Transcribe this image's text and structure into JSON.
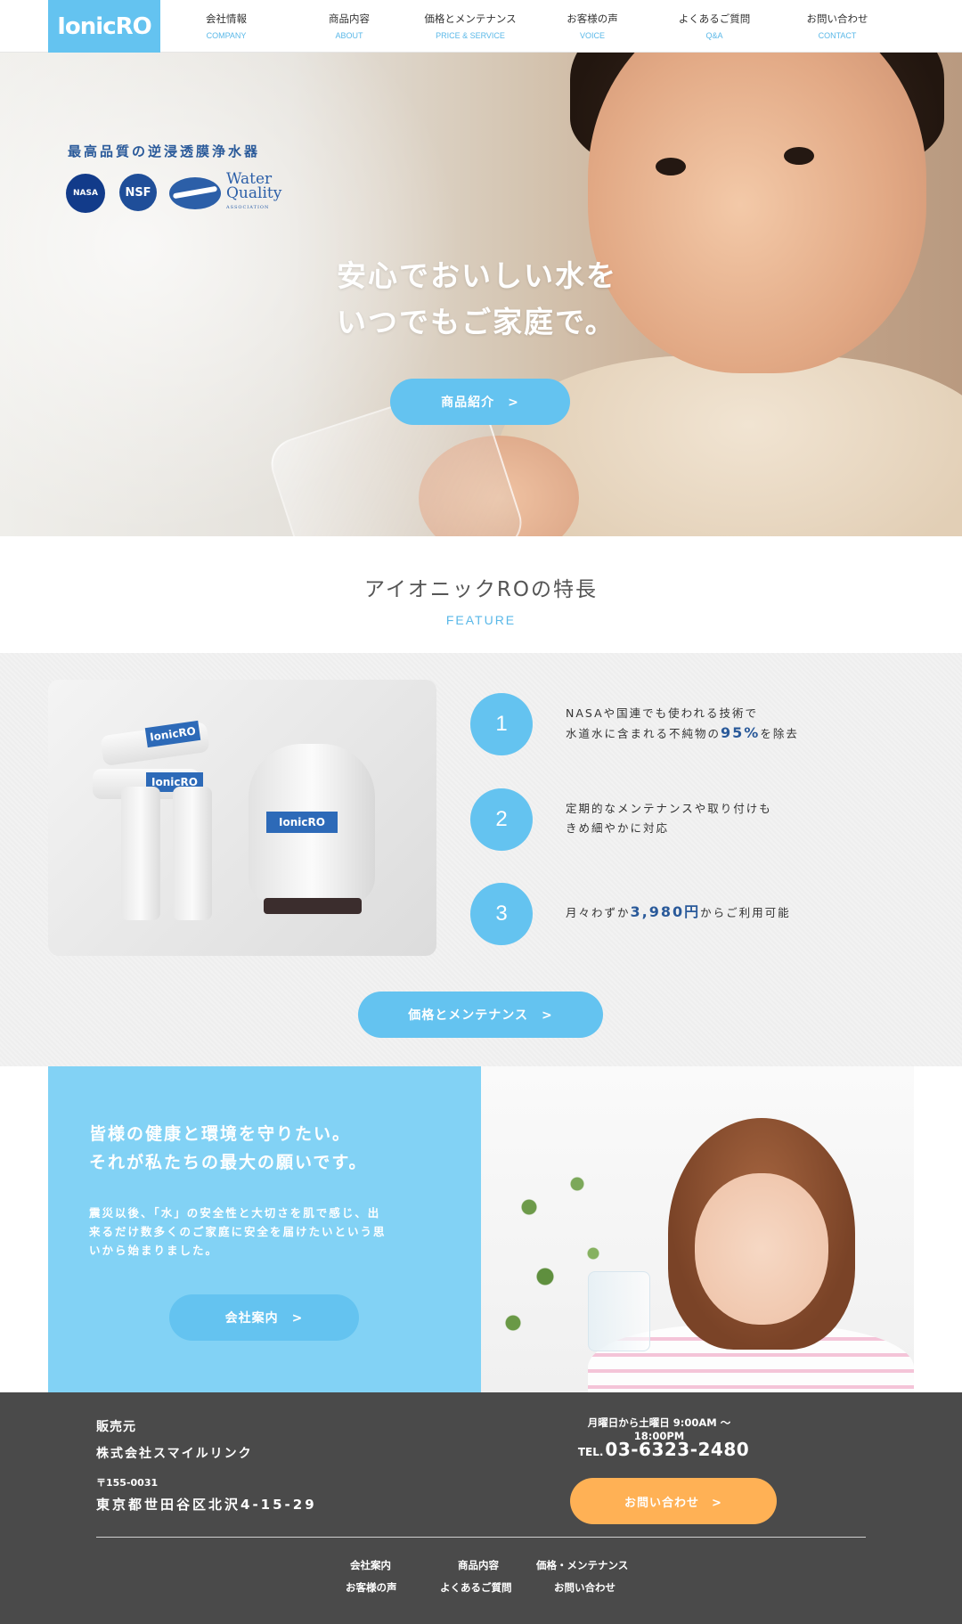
{
  "header": {
    "logo": "IonicRO",
    "nav": [
      {
        "ja": "会社情報",
        "en": "COMPANY"
      },
      {
        "ja": "商品内容",
        "en": "ABOUT"
      },
      {
        "ja": "価格とメンテナンス",
        "en": "PRICE & SERVICE"
      },
      {
        "ja": "お客様の声",
        "en": "VOICE"
      },
      {
        "ja": "よくあるご質問",
        "en": "Q&A"
      },
      {
        "ja": "お問い合わせ",
        "en": "CONTACT"
      }
    ]
  },
  "hero": {
    "tagline": "最高品質の逆浸透膜浄水器",
    "certifications": {
      "nasa": "NASA",
      "nsf": "NSF",
      "wqa_1": "Water",
      "wqa_2": "Quality",
      "wqa_3": "ASSOCIATION"
    },
    "title_line1": "安心でおいしい水を",
    "title_line2": "いつでもご家庭で。",
    "button": "商品紹介　>"
  },
  "feature": {
    "title": "アイオニックROの特長",
    "subtitle": "FEATURE",
    "product_labels": [
      "IonicRO",
      "IonicRO",
      "IonicRO"
    ],
    "items": [
      {
        "num": "1",
        "line1": "NASAや国連でも使われる技術で",
        "line2_pre": "水道水に含まれる不純物の",
        "line2_hl": "95%",
        "line2_post": "を除去"
      },
      {
        "num": "2",
        "line1": "定期的なメンテナンスや取り付けも",
        "line2": "きめ細やかに対応"
      },
      {
        "num": "3",
        "pre": "月々わずか",
        "hl": "3,980円",
        "post": "からご利用可能"
      }
    ],
    "button": "価格とメンテナンス　>"
  },
  "mission": {
    "title_line1": "皆様の健康と環境を守りたい。",
    "title_line2": "それが私たちの最大の願いです。",
    "text_line1": "震災以後、「水」の安全性と大切さを肌で感じ、出",
    "text_line2": "来るだけ数多くのご家庭に安全を届けたいという思",
    "text_line3": "いから始まりました。",
    "button": "会社案内　>"
  },
  "footer": {
    "seller_label": "販売元",
    "seller_name": "株式会社スマイルリンク",
    "zip": "〒155-0031",
    "address": "東京都世田谷区北沢4-15-29",
    "hours": "月曜日から土曜日 9:00AM 〜 18:00PM",
    "tel_prefix": "TEL.",
    "tel": "03-6323-2480",
    "contact_button": "お問い合わせ　>",
    "links": [
      "会社案内",
      "商品内容",
      "価格・メンテナンス",
      "お客様の声",
      "よくあるご質問",
      "お問い合わせ"
    ]
  },
  "colors": {
    "accent": "#64c3f0",
    "mission_bg": "#82d2f5",
    "footer_bg": "#4a4a4a",
    "contact": "#ffb155",
    "highlight": "#2a5a9a"
  }
}
